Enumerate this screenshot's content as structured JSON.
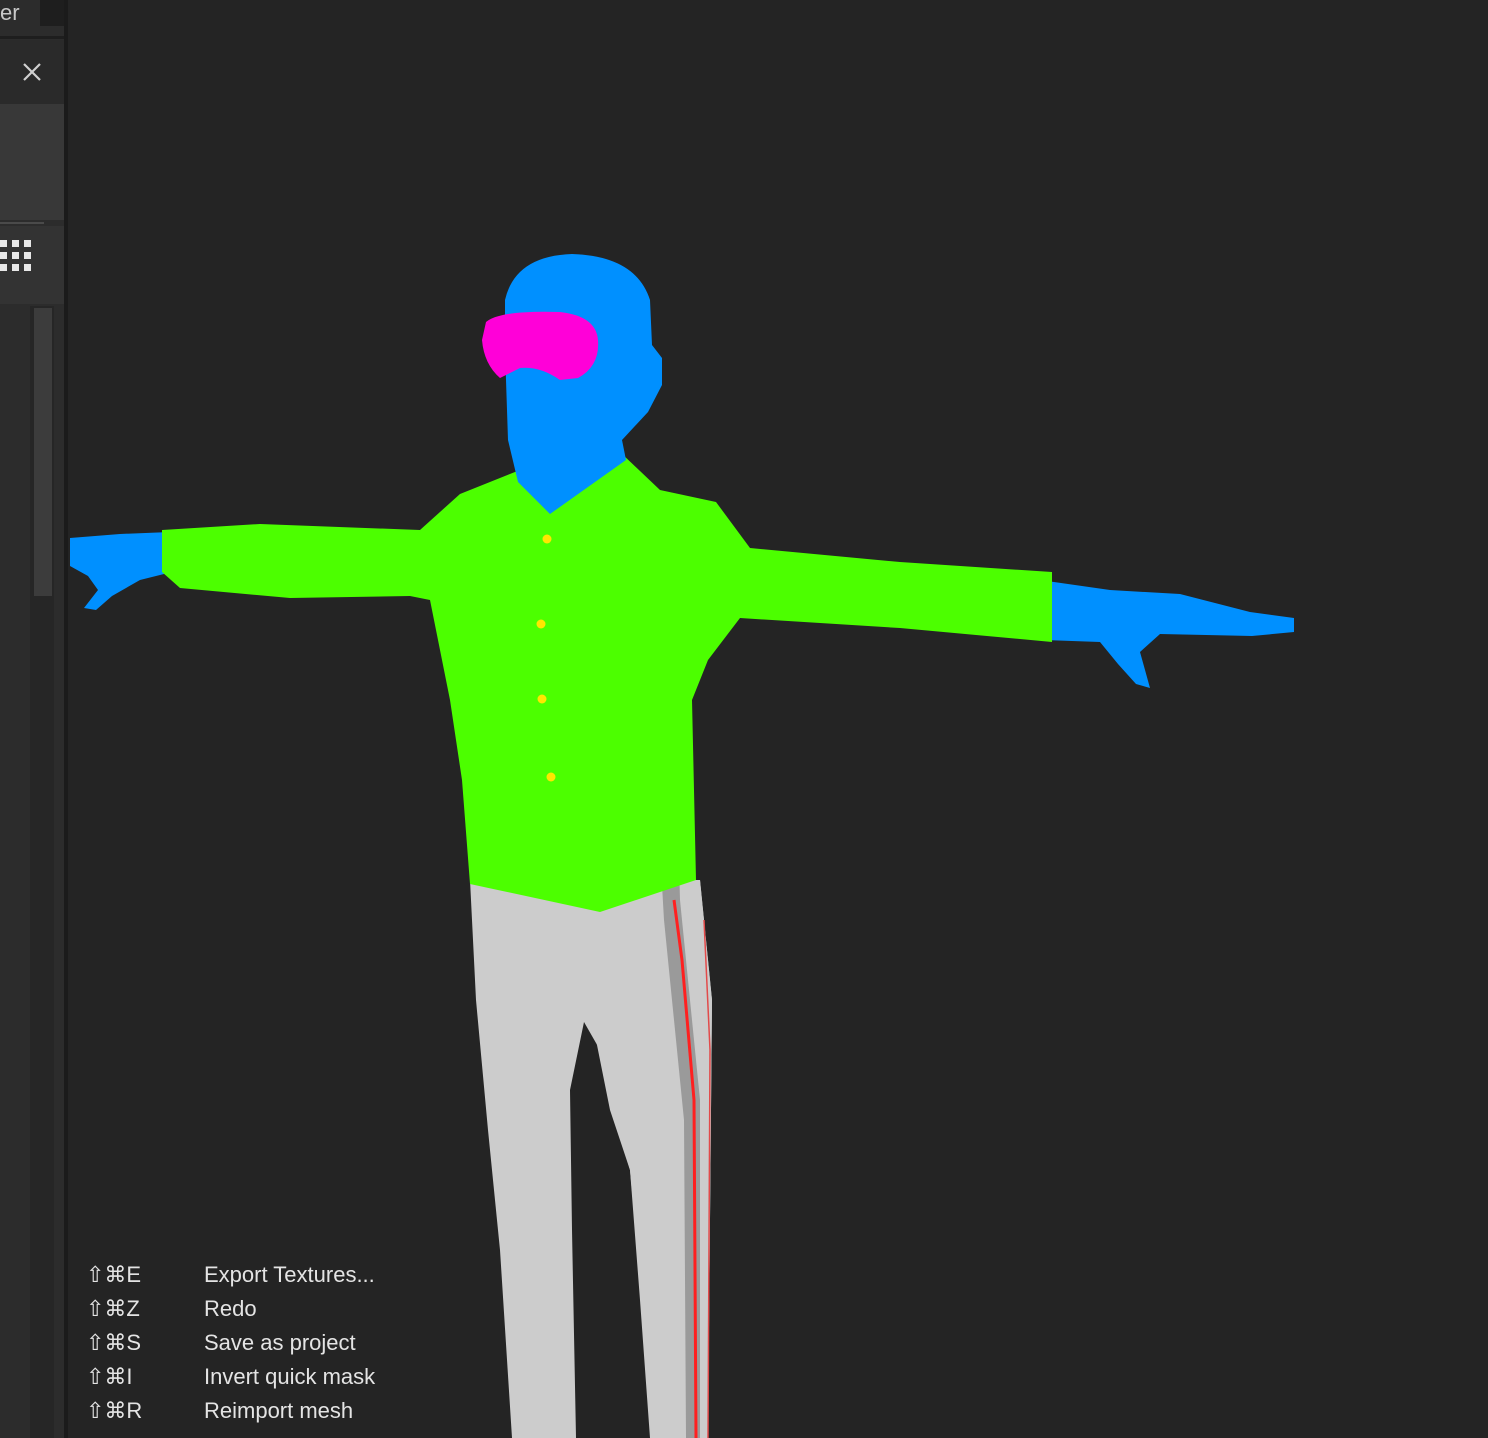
{
  "panel": {
    "tab_label": "er",
    "close_icon": "close-icon",
    "grid_icon": "grid-icon"
  },
  "viewport": {
    "colors": {
      "background": "#242424",
      "skin": "#0090ff",
      "shirt": "#4cff00",
      "goggles": "#ff00d8",
      "pants": "#cccccc",
      "buttons": "#ffe600",
      "seam": "#ff2020"
    }
  },
  "shortcuts": [
    {
      "keys": "⇧⌘E",
      "label": "Export Textures..."
    },
    {
      "keys": "⇧⌘Z",
      "label": "Redo"
    },
    {
      "keys": "⇧⌘S",
      "label": "Save as project"
    },
    {
      "keys": "⇧⌘I",
      "label": "Invert quick mask"
    },
    {
      "keys": "⇧⌘R",
      "label": "Reimport mesh"
    }
  ]
}
